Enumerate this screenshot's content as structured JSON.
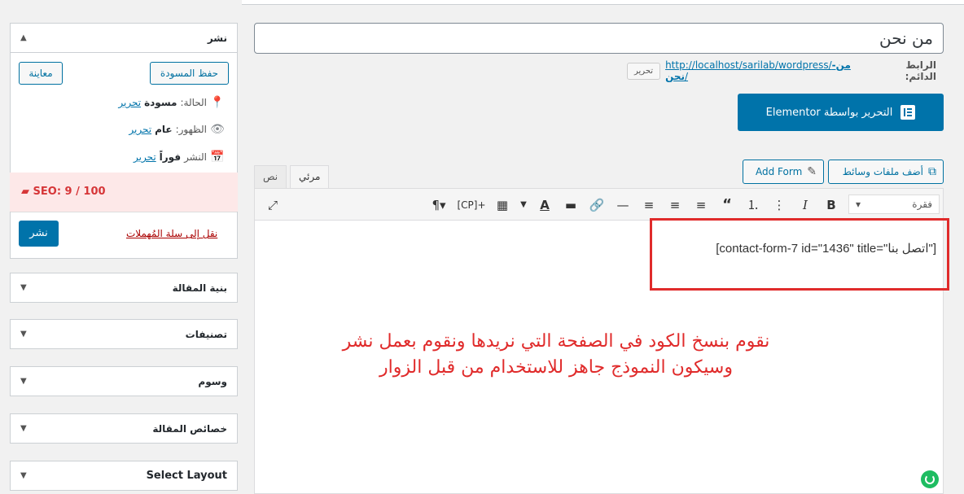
{
  "title_field": {
    "value": "من نحن"
  },
  "permalink": {
    "label": "الرابط الدائم:",
    "base": "http://localhost/sarilab/wordpress/",
    "slug": "من-نحن",
    "trail": "/",
    "edit_label": "تحرير"
  },
  "elementor_button": {
    "label": "التحرير بواسطة Elementor"
  },
  "media_buttons": {
    "add_media": "أضف ملفات وسائط",
    "add_form": "Add Form"
  },
  "editor_tabs": {
    "visual": "مرئي",
    "text": "نص"
  },
  "toolbar": {
    "format_select": "فقرة",
    "cp_label": "[CP]+"
  },
  "editor_content": {
    "shortcode": "[contact-form-7 id=\"1436\" title=\"اتصل بنا\"]"
  },
  "annotation": {
    "line1": "نقوم بنسخ الكود في الصفحة التي نريدها ونقوم بعمل نشر",
    "line2": "وسيكون النموذج جاهز للاستخدام من قبل الزوار",
    "color": "#e02b2b"
  },
  "publish_box": {
    "title": "نشر",
    "save_draft": "حفظ المسودة",
    "preview": "معاينة",
    "status_label": "الحالة:",
    "status_value": "مسودة",
    "visibility_label": "الظهور:",
    "visibility_value": "عام",
    "publish_label": "النشر",
    "publish_value": "فوراً",
    "edit_link": "تحرير",
    "seo_score": "SEO: 9 / 100",
    "trash_link": "نقل إلى سلة المُهملات",
    "publish_button": "نشر"
  },
  "side_boxes": [
    {
      "title": "بنية المقالة"
    },
    {
      "title": "تصنيفات"
    },
    {
      "title": "وسوم"
    },
    {
      "title": "خصائص المقالة"
    },
    {
      "title": "Select Layout"
    }
  ],
  "colors": {
    "primary": "#0073aa",
    "seo_bad": "#d63638",
    "highlight": "#e02b2b"
  }
}
